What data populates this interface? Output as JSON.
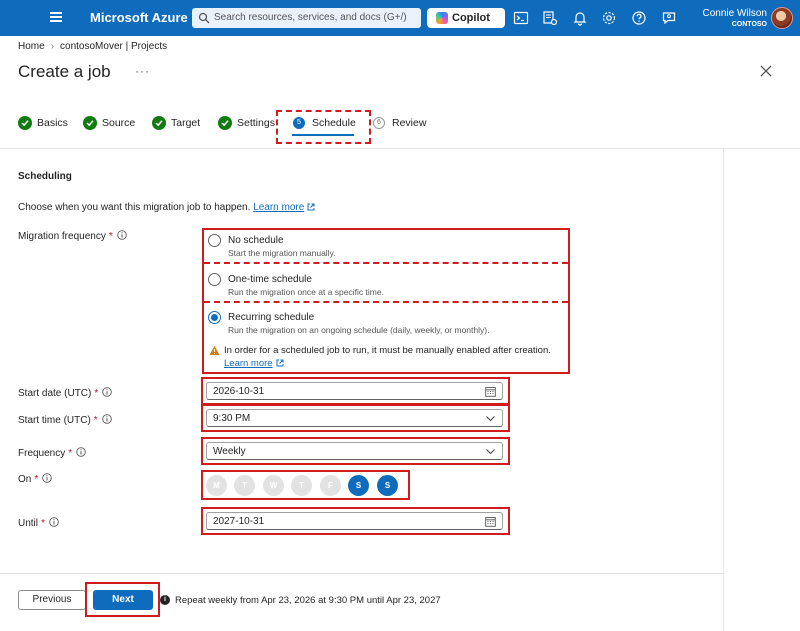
{
  "topbar": {
    "brand": "Microsoft Azure",
    "search_placeholder": "Search resources, services, and docs (G+/)",
    "copilot_label": "Copilot",
    "user_name": "Connie Wilson",
    "user_org": "CONTOSO",
    "icons": [
      "cloud-shell-icon",
      "directory-filter-icon",
      "notifications-icon",
      "settings-icon",
      "help-icon",
      "feedback-icon"
    ]
  },
  "breadcrumb": {
    "home": "Home",
    "project": "contosoMover | Projects"
  },
  "title": "Create a job",
  "more": "···",
  "steps": [
    {
      "label": "Basics",
      "state": "done"
    },
    {
      "label": "Source",
      "state": "done"
    },
    {
      "label": "Target",
      "state": "done"
    },
    {
      "label": "Settings",
      "state": "done"
    },
    {
      "label": "Schedule",
      "number": "5",
      "state": "active"
    },
    {
      "label": "Review",
      "number": "6",
      "state": "pending"
    }
  ],
  "section_title": "Scheduling",
  "intro_text": "Choose when you want this migration job to happen.",
  "learn_more": "Learn more",
  "migration_frequency": {
    "label": "Migration frequency",
    "options": [
      {
        "title": "No schedule",
        "desc": "Start the migration manually.",
        "selected": false
      },
      {
        "title": "One-time schedule",
        "desc": "Run the migration once at a specific time.",
        "selected": false
      },
      {
        "title": "Recurring schedule",
        "desc": "Run the migration on an ongoing schedule (daily, weekly, or monthly).",
        "selected": true
      }
    ],
    "warning": "In order for a scheduled job to run, it must be manually enabled after creation.",
    "warning_link": "Learn more"
  },
  "start_date": {
    "label": "Start date (UTC)",
    "value": "2026-10-31"
  },
  "start_time": {
    "label": "Start time (UTC)",
    "value": "9:30 PM"
  },
  "frequency": {
    "label": "Frequency",
    "value": "Weekly"
  },
  "on": {
    "label": "On",
    "days": [
      {
        "letter": "M",
        "selected": false
      },
      {
        "letter": "T",
        "selected": false
      },
      {
        "letter": "W",
        "selected": false
      },
      {
        "letter": "T",
        "selected": false
      },
      {
        "letter": "F",
        "selected": false
      },
      {
        "letter": "S",
        "selected": true
      },
      {
        "letter": "S",
        "selected": true
      }
    ]
  },
  "until": {
    "label": "Until",
    "value": "2027-10-31"
  },
  "footer": {
    "previous": "Previous",
    "next": "Next",
    "summary_icon": "i",
    "summary": "Repeat weekly from Apr 23, 2026 at 9:30 PM until Apr 23, 2027"
  },
  "colors": {
    "accent": "#0f6cbd",
    "success": "#107c10",
    "highlight": "#d01c1c",
    "required": "#c50f1f"
  }
}
